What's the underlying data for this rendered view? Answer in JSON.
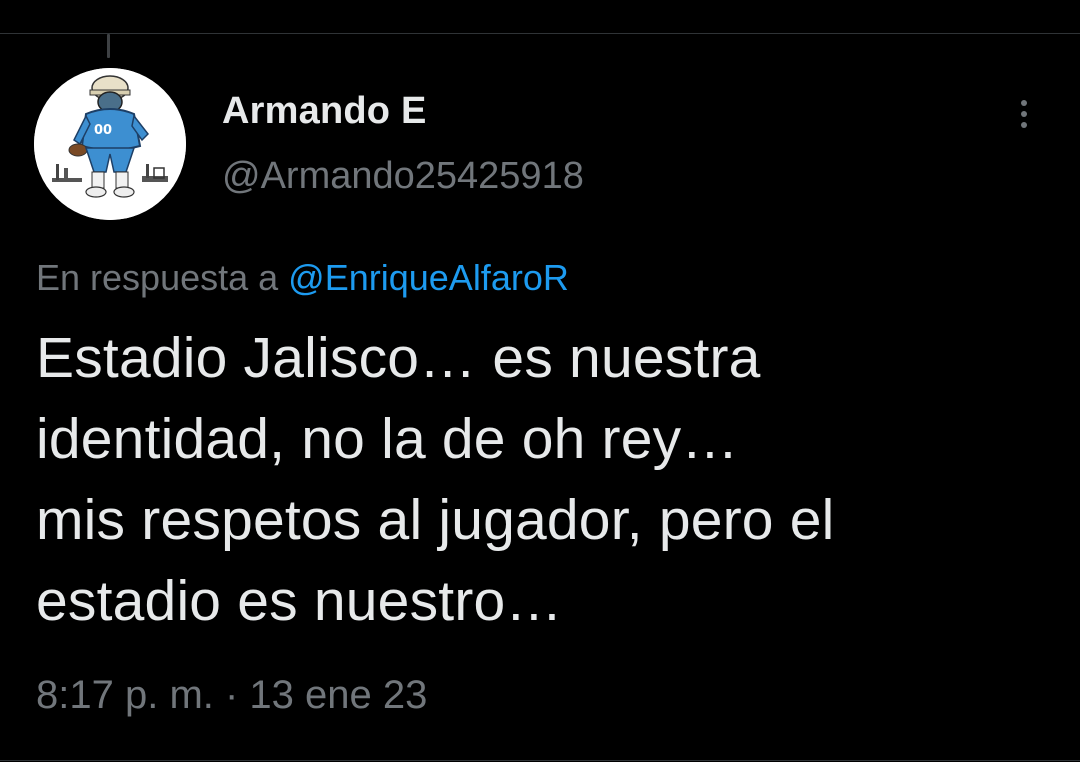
{
  "tweet": {
    "display_name": "Armando E",
    "handle": "@Armando25425918",
    "reply_prefix": "En respuesta a",
    "reply_mention": "@EnriqueAlfaroR",
    "text": "Estadio Jalisco… es nuestra\nidentidad, no la de oh rey…\nmis respetos al jugador, pero el\nestadio es nuestro…",
    "timestamp": "8:17 p. m. · 13 ene 23"
  },
  "icons": {
    "more": "more-options-icon",
    "avatar": "football-player-cartoon"
  },
  "colors": {
    "background": "#000000",
    "primary_text": "#e7e9ea",
    "secondary_text": "#71767b",
    "link": "#1d9bf0",
    "divider": "#2f3336"
  }
}
